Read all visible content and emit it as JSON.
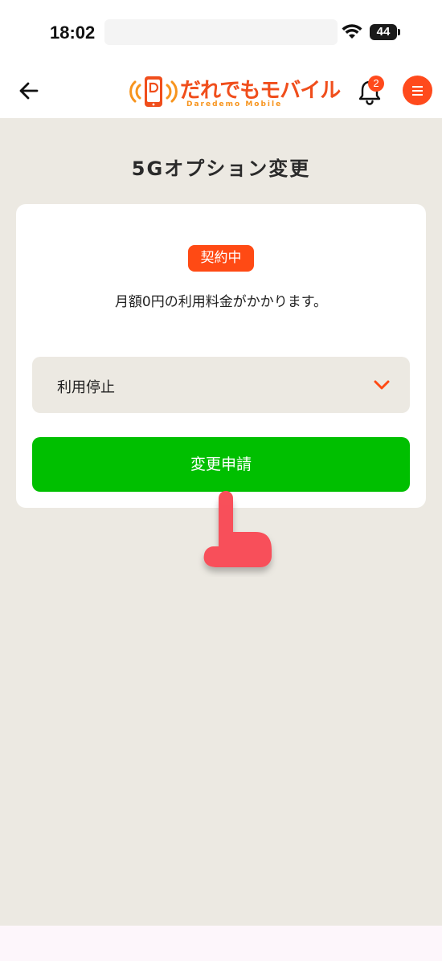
{
  "status_bar": {
    "time": "18:02",
    "battery": "44"
  },
  "header": {
    "logo_text": "だれでもモバイル",
    "logo_sub": "Daredemo Mobile",
    "notification_count": "2",
    "brand_color": "#ff4a1c"
  },
  "page": {
    "title": "5Gオプション変更"
  },
  "card": {
    "status_badge": "契約中",
    "fee_text": "月額0円の利用料金がかかります。",
    "select_value": "利用停止",
    "submit_label": "変更申請",
    "submit_color": "#00bf00"
  },
  "icons": [
    "back-arrow-icon",
    "bell-icon",
    "hamburger-menu-icon",
    "chevron-down-icon",
    "wifi-icon",
    "battery-icon",
    "pointing-hand-icon"
  ]
}
